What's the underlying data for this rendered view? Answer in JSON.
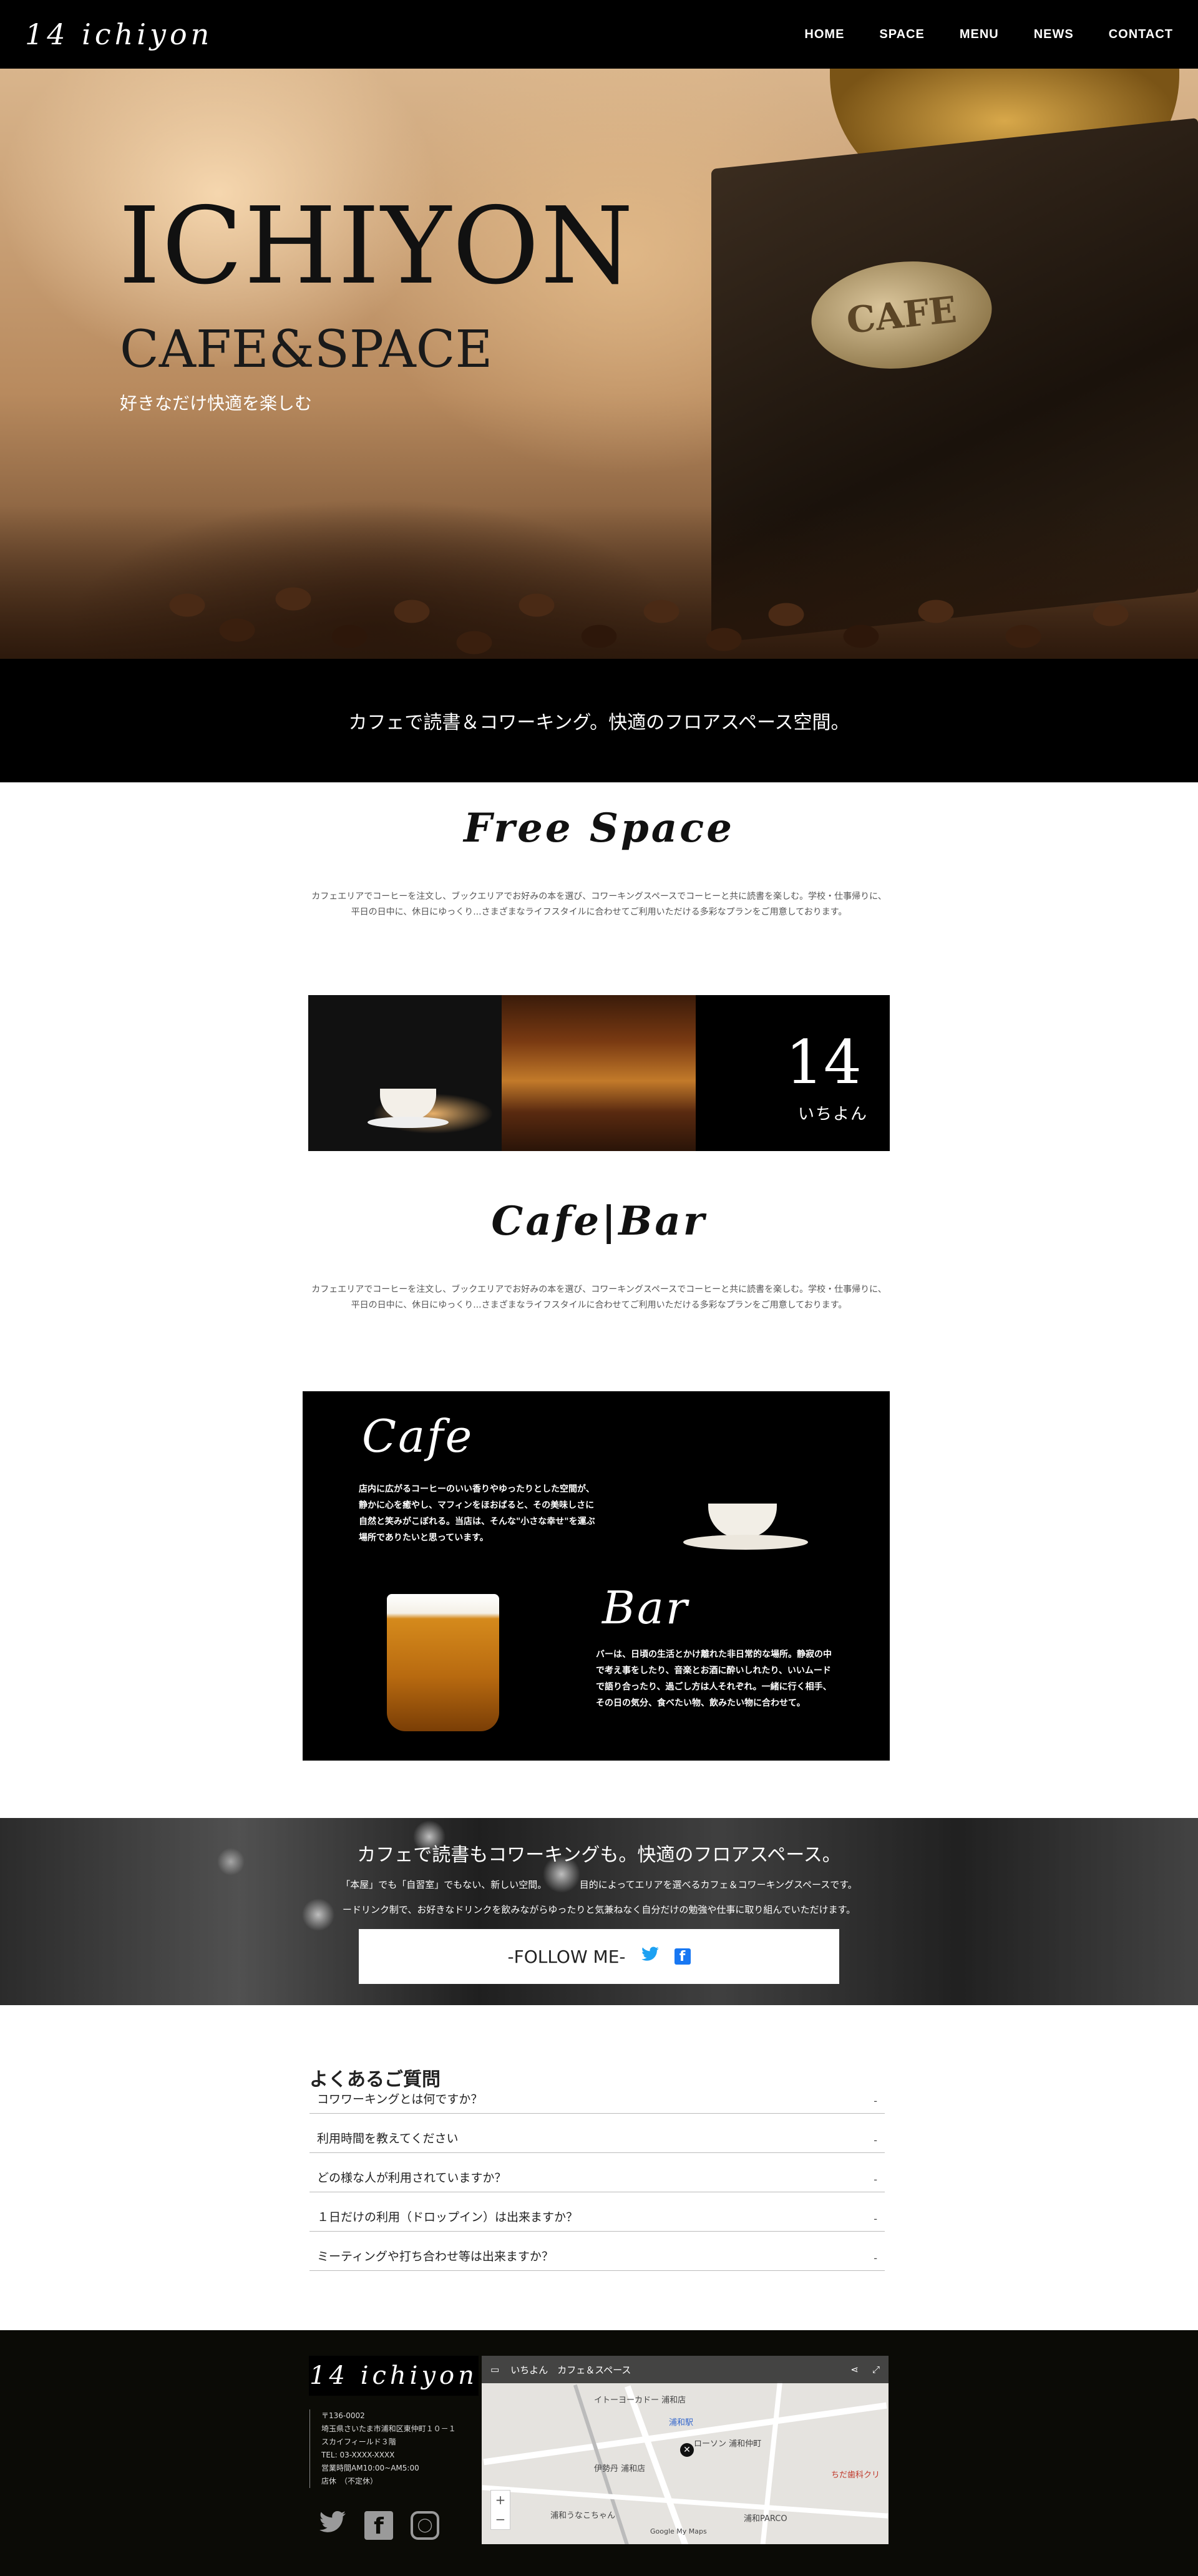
{
  "header": {
    "logo": "14 ichiyon",
    "nav": [
      "HOME",
      "SPACE",
      "MENU",
      "NEWS",
      "CONTACT"
    ]
  },
  "hero": {
    "title": "ICHIYON",
    "subtitle": "CAFE&SPACE",
    "tagline": "好きなだけ快適を楽しむ",
    "plate_text": "CAFE"
  },
  "band": {
    "text": "カフェで読書＆コワーキング。快適のフロアスペース空間。"
  },
  "free_space": {
    "heading": "Free Space",
    "text": "カフェエリアでコーヒーを注文し、ブックエリアでお好みの本を選び、コワーキングスペースでコーヒーと共に読書を楽しむ。学校・仕事帰りに、平日の日中に、休日にゆっくり...さまざまなライフスタイルに合わせてご利用いただける多彩なプランをご用意しております。",
    "logo_big": "14",
    "logo_small": "いちよん"
  },
  "cafe_bar": {
    "heading": "Cafe|Bar",
    "text": "カフェエリアでコーヒーを注文し、ブックエリアでお好みの本を選び、コワーキングスペースでコーヒーと共に読書を楽しむ。学校・仕事帰りに、平日の日中に、休日にゆっくり...さまざまなライフスタイルに合わせてご利用いただける多彩なプランをご用意しております。",
    "cafe_title": "Cafe",
    "cafe_text": "店内に広がるコーヒーのいい香りやゆったりとした空間が、静かに心を癒やし、マフィンをほおばると、その美味しさに自然と笑みがこぼれる。当店は、そんな\"小さな幸せ\"を運ぶ場所でありたいと思っています。",
    "bar_title": "Bar",
    "bar_text": "バーは、日頃の生活とかけ離れた非日常的な場所。静寂の中で考え事をしたり、音楽とお酒に酔いしれたり、いいムードで語り合ったり、過ごし方は人それぞれ。一緒に行く相手、その日の気分、食べたい物、飲みたい物に合わせて。"
  },
  "promo": {
    "heading": "カフェで読書もコワーキングも。快適のフロアスペース。",
    "line1": "「本屋」でも「自習室」でもない、新しい空間。　　　　目的によってエリアを選べるカフェ＆コワーキングスペースです。",
    "line2": "ードリンク制で、お好きなドリンクを飲みながらゆったりと気兼ねなく自分だけの勉強や仕事に取り組んでいただけます。",
    "follow_label": "-FOLLOW ME-"
  },
  "faq": {
    "title": "よくあるご質問",
    "items": [
      {
        "q": "コワワーキングとは何ですか？",
        "mark": "-"
      },
      {
        "q": "利用時間を教えてください",
        "mark": "-"
      },
      {
        "q": "どの様な人が利用されていますか？",
        "mark": "-"
      },
      {
        "q": "１日だけの利用（ドロップイン）は出来ますか？",
        "mark": "-"
      },
      {
        "q": "ミーティングや打ち合わせ等は出来ますか？",
        "mark": "-"
      }
    ]
  },
  "footer": {
    "logo": "14 ichiyon",
    "address": [
      "〒136-0002",
      "埼玉県さいたま市浦和区東仲町１０－１",
      "スカイフィールド３階",
      "TEL: 03-XXXX-XXXX",
      "営業時間AM10:00~AM5:00",
      "店休　（不定休）"
    ],
    "map_title": "いちよん　カフェ＆スペース",
    "map_labels": [
      "イトーヨーカドー 浦和店",
      "浦和駅",
      "ローソン 浦和仲町",
      "浦和PARCO",
      "伊勢丹 浦和店",
      "ちだ歯科クリ",
      "浦和うなこちゃん",
      "Google My Maps"
    ]
  }
}
